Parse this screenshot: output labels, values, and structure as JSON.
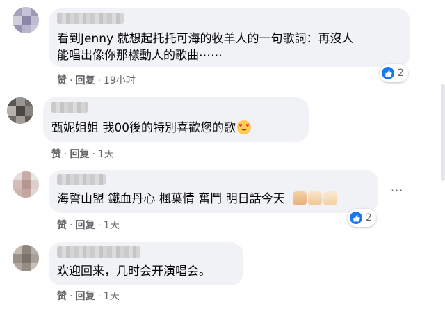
{
  "colors": {
    "bubble_bg": "#f0f2f5",
    "link_blue": "#1877f2",
    "meta_gray": "#65676b",
    "text": "#050505"
  },
  "comments": [
    {
      "text_lines": [
        "看到Jenny 就想起托托可海的牧羊人的一句歌詞：再沒人",
        "能唱出像你那樣動人的歌曲⋯⋯"
      ],
      "like_label": "赞",
      "reply_label": "回复",
      "time": "19小时",
      "reaction_icon": "like-icon",
      "reaction_count": "2"
    },
    {
      "text_lines": [
        "甄妮姐姐 我00後的特別喜歡您的歌"
      ],
      "emoji": "heart-eyes-emoji",
      "like_label": "赞",
      "reply_label": "回复",
      "time": "1天"
    },
    {
      "text_lines": [
        "海誓山盟 鐵血丹心 楓葉情 奮鬥 明日話今天"
      ],
      "emojis": [
        "fist-emoji",
        "muscle-emoji",
        "thumbs-up-emoji"
      ],
      "like_label": "赞",
      "reply_label": "回复",
      "time": "1天",
      "reaction_icon": "like-icon",
      "reaction_count": "2",
      "more_icon": "more-options-icon"
    },
    {
      "text_lines": [
        "欢迎回来，几时会开演唱会。"
      ],
      "like_label": "赞",
      "reply_label": "回复",
      "time": "1天"
    }
  ]
}
